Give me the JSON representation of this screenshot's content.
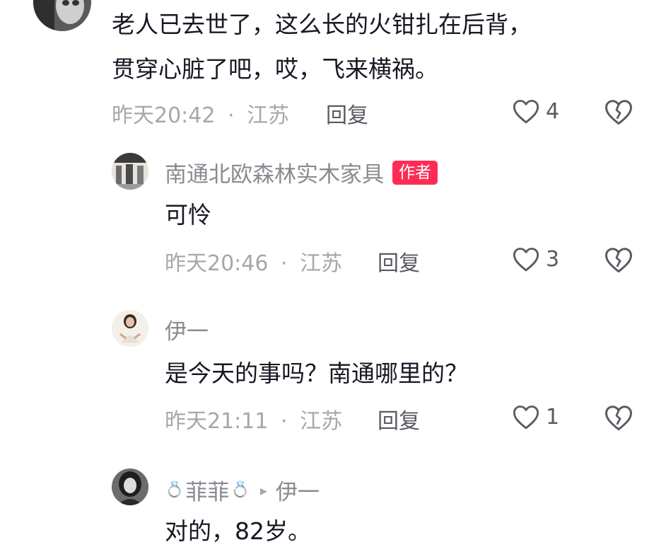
{
  "comments": [
    {
      "text_lines": [
        "老人已去世了，这么长的火钳扎在后背，",
        "贯穿心脏了吧，哎，飞来横祸。"
      ],
      "time": "昨天20:42",
      "location": "江苏",
      "meta_sep": "·",
      "reply_label": "回复",
      "like_count": "4"
    }
  ],
  "replies": [
    {
      "author": "南通北欧森林实木家具",
      "badge": "作者",
      "text": "可怜",
      "time": "昨天20:46",
      "location": "江苏",
      "meta_sep": "·",
      "reply_label": "回复",
      "like_count": "3"
    },
    {
      "author": "伊一",
      "text": "是今天的事吗？南通哪里的？",
      "time": "昨天21:11",
      "location": "江苏",
      "meta_sep": "·",
      "reply_label": "回复",
      "like_count": "1"
    },
    {
      "author": "菲菲",
      "author_deco": "💍",
      "reply_to_arrow": "▸",
      "reply_to": "伊一",
      "text": "对的，82岁。"
    }
  ],
  "icons": {
    "like": "heart-outline-icon",
    "dislike": "broken-heart-icon",
    "reply_arrow": "play-arrow-icon"
  },
  "colors": {
    "badge_bg": "#fe2c55",
    "meta_text": "#a6a7ab",
    "author_text": "#8a8b91",
    "body_text": "#161823"
  }
}
